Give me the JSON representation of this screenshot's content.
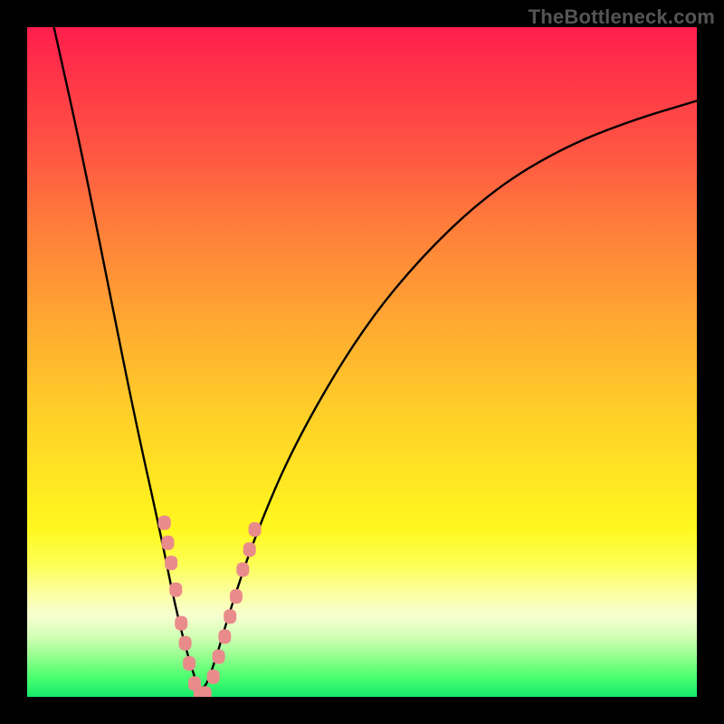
{
  "watermark": "TheBottleneck.com",
  "chart_data": {
    "type": "line",
    "title": "",
    "xlabel": "",
    "ylabel": "",
    "xlim": [
      0,
      100
    ],
    "ylim": [
      0,
      100
    ],
    "legend": false,
    "grid": false,
    "background_gradient": {
      "direction": "top-to-bottom",
      "stops": [
        {
          "pos": 0.0,
          "color": "#ff1e4e",
          "meaning": "worst"
        },
        {
          "pos": 0.5,
          "color": "#ffc82a",
          "meaning": "mid"
        },
        {
          "pos": 0.8,
          "color": "#fdff52",
          "meaning": "good"
        },
        {
          "pos": 1.0,
          "color": "#14e96a",
          "meaning": "best"
        }
      ]
    },
    "series": [
      {
        "name": "bottleneck-curve",
        "kind": "V-shape",
        "minimum_x": 26,
        "x": [
          4,
          8,
          12,
          16,
          20,
          22,
          24,
          26,
          28,
          30,
          34,
          40,
          50,
          60,
          70,
          80,
          90,
          100
        ],
        "y": [
          100,
          82,
          62,
          42,
          24,
          14,
          6,
          0,
          5,
          12,
          24,
          38,
          55,
          67,
          76,
          82,
          86,
          89
        ]
      }
    ],
    "markers": {
      "name": "highlight-dots",
      "color": "#e98b8b",
      "shape": "rounded",
      "points": [
        {
          "x": 20.5,
          "y": 26
        },
        {
          "x": 21.0,
          "y": 23
        },
        {
          "x": 21.5,
          "y": 20
        },
        {
          "x": 22.2,
          "y": 16
        },
        {
          "x": 23.0,
          "y": 11
        },
        {
          "x": 23.6,
          "y": 8
        },
        {
          "x": 24.2,
          "y": 5
        },
        {
          "x": 25.0,
          "y": 2
        },
        {
          "x": 25.8,
          "y": 0.5
        },
        {
          "x": 26.6,
          "y": 0.5
        },
        {
          "x": 27.8,
          "y": 3
        },
        {
          "x": 28.6,
          "y": 6
        },
        {
          "x": 29.5,
          "y": 9
        },
        {
          "x": 30.3,
          "y": 12
        },
        {
          "x": 31.2,
          "y": 15
        },
        {
          "x": 32.2,
          "y": 19
        },
        {
          "x": 33.2,
          "y": 22
        },
        {
          "x": 34.0,
          "y": 25
        }
      ]
    }
  }
}
